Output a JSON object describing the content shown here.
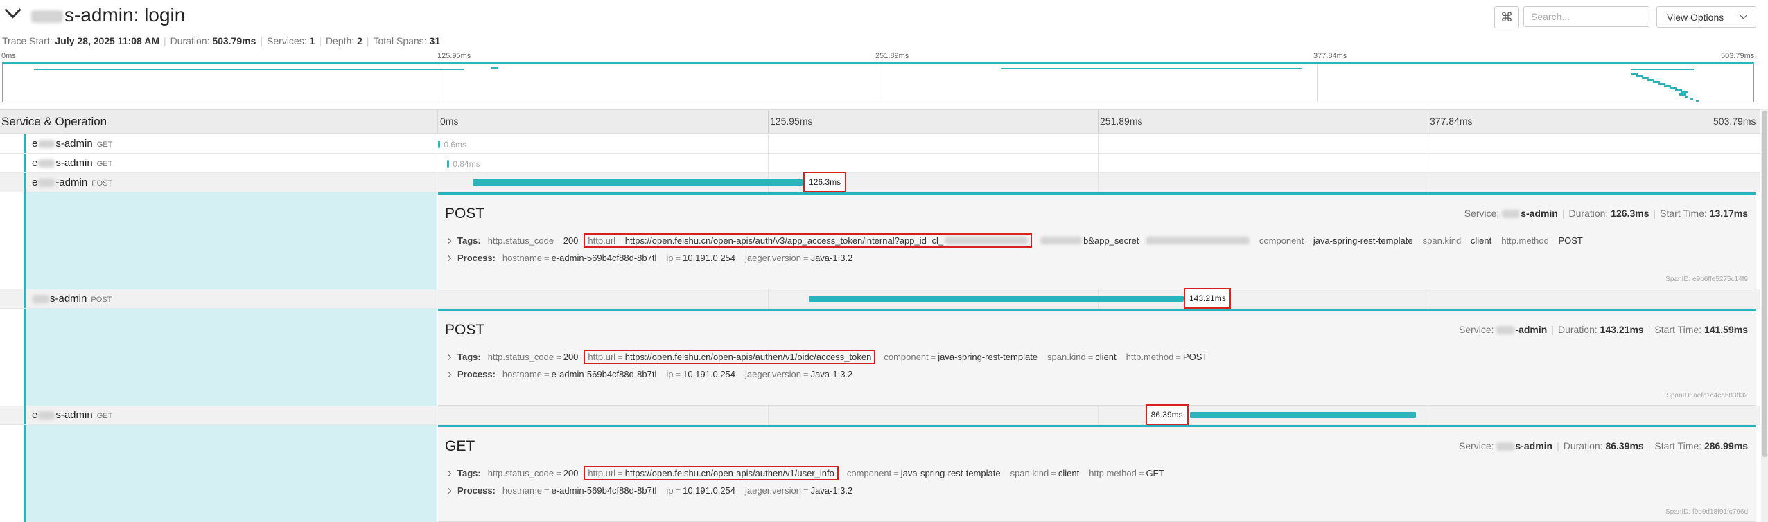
{
  "header": {
    "title": "s-admin: login",
    "meta": [
      {
        "label": "Trace Start:",
        "value": "July 28, 2025 11:08 AM"
      },
      {
        "label": "Duration:",
        "value": "503.79ms"
      },
      {
        "label": "Services:",
        "value": "1"
      },
      {
        "label": "Depth:",
        "value": "2"
      },
      {
        "label": "Total Spans:",
        "value": "31"
      }
    ],
    "search_placeholder": "Search...",
    "view_options_label": "View Options",
    "cmd_icon": "⌘"
  },
  "ticks": [
    "0ms",
    "125.95ms",
    "251.89ms",
    "377.84ms",
    "503.79ms"
  ],
  "columns": {
    "service_operation": "Service & Operation"
  },
  "rows": [
    {
      "service": "s-admin",
      "prefix": "e",
      "op": "GET",
      "duration_ms": 0.6,
      "start_ms": 0.1,
      "label": "0.6ms"
    },
    {
      "service": "s-admin",
      "prefix": "e",
      "op": "GET",
      "duration_ms": 0.84,
      "start_ms": 3.5,
      "label": "0.84ms"
    },
    {
      "service": "-admin",
      "prefix": "e",
      "op": "POST",
      "duration_ms": 126.3,
      "start_ms": 13.17,
      "label": "126.3ms"
    },
    {
      "service": "s-admin",
      "prefix": "",
      "op": "POST",
      "duration_ms": 143.21,
      "start_ms": 141.59,
      "label": "143.21ms"
    },
    {
      "service": "s-admin",
      "prefix": "e",
      "op": "GET",
      "duration_ms": 86.39,
      "start_ms": 286.99,
      "label": "86.39ms"
    }
  ],
  "details": [
    {
      "title": "POST",
      "summary": [
        {
          "label": "Service:",
          "value": "s-admin"
        },
        {
          "label": "Duration:",
          "value": "126.3ms"
        },
        {
          "label": "Start Time:",
          "value": "13.17ms"
        }
      ],
      "tags_label": "Tags:",
      "process_label": "Process:",
      "tags": [
        {
          "k": "http.status_code",
          "v": "200"
        },
        {
          "k": "http.url",
          "v": "https://open.feishu.cn/open-apis/auth/v3/app_access_token/internal?app_id=cl_",
          "red": true
        },
        {
          "k": "",
          "v": "b&app_secret=",
          "blur": true
        },
        {
          "k": "component",
          "v": "java-spring-rest-template"
        },
        {
          "k": "span.kind",
          "v": "client"
        },
        {
          "k": "http.method",
          "v": "POST"
        }
      ],
      "process": [
        {
          "k": "hostname",
          "v": "e-admin-569b4cf88d-8b7tl"
        },
        {
          "k": "ip",
          "v": "10.191.0.254"
        },
        {
          "k": "jaeger.version",
          "v": "Java-1.3.2"
        }
      ],
      "span_id": "SpanID: e9b6ffe5275c14f9"
    },
    {
      "title": "POST",
      "summary": [
        {
          "label": "Service:",
          "value": "-admin"
        },
        {
          "label": "Duration:",
          "value": "143.21ms"
        },
        {
          "label": "Start Time:",
          "value": "141.59ms"
        }
      ],
      "tags_label": "Tags:",
      "process_label": "Process:",
      "tags": [
        {
          "k": "http.status_code",
          "v": "200"
        },
        {
          "k": "http.url",
          "v": "https://open.feishu.cn/open-apis/authen/v1/oidc/access_token",
          "red": true
        },
        {
          "k": "component",
          "v": "java-spring-rest-template"
        },
        {
          "k": "span.kind",
          "v": "client"
        },
        {
          "k": "http.method",
          "v": "POST"
        }
      ],
      "process": [
        {
          "k": "hostname",
          "v": "e-admin-569b4cf88d-8b7tl"
        },
        {
          "k": "ip",
          "v": "10.191.0.254"
        },
        {
          "k": "jaeger.version",
          "v": "Java-1.3.2"
        }
      ],
      "span_id": "SpanID: aefc1c4cb583ff32"
    },
    {
      "title": "GET",
      "summary": [
        {
          "label": "Service:",
          "value": "s-admin"
        },
        {
          "label": "Duration:",
          "value": "86.39ms"
        },
        {
          "label": "Start Time:",
          "value": "286.99ms"
        }
      ],
      "tags_label": "Tags:",
      "process_label": "Process:",
      "tags": [
        {
          "k": "http.status_code",
          "v": "200"
        },
        {
          "k": "http.url",
          "v": "https://open.feishu.cn/open-apis/authen/v1/user_info",
          "red": true
        },
        {
          "k": "component",
          "v": "java-spring-rest-template"
        },
        {
          "k": "span.kind",
          "v": "client"
        },
        {
          "k": "http.method",
          "v": "GET"
        }
      ],
      "process": [
        {
          "k": "hostname",
          "v": "e-admin-569b4cf88d-8b7tl"
        },
        {
          "k": "ip",
          "v": "10.191.0.254"
        },
        {
          "k": "jaeger.version",
          "v": "Java-1.3.2"
        }
      ],
      "span_id": "SpanID: f9d9d18f91fc796d"
    }
  ],
  "colors": {
    "accent": "#2ab3ba",
    "highlight_border": "#d72020",
    "detail_bg": "#d4f0f2"
  }
}
